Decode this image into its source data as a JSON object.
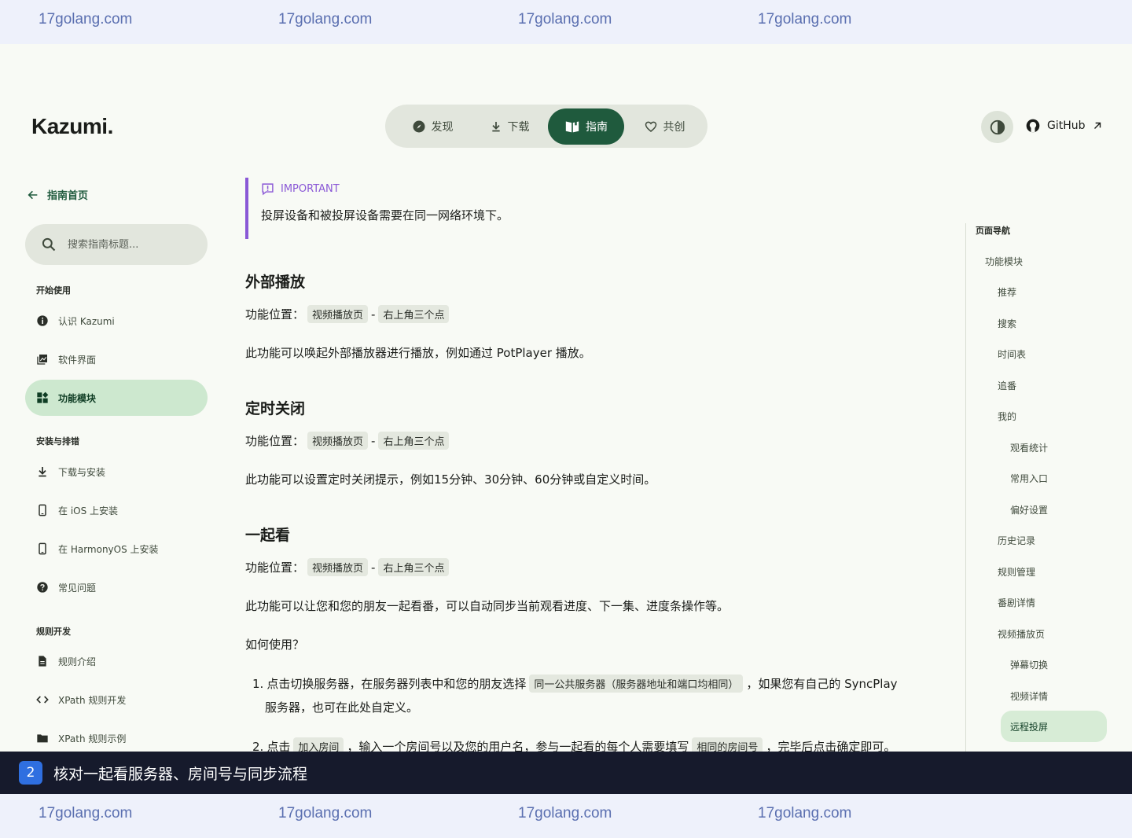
{
  "watermark": {
    "text": "17golang.com"
  },
  "brand": {
    "logo": "Kazumi."
  },
  "topnav": {
    "items": [
      {
        "label": "发现",
        "icon": "compass-icon"
      },
      {
        "label": "下载",
        "icon": "download-icon"
      },
      {
        "label": "指南",
        "icon": "book-icon"
      },
      {
        "label": "共创",
        "icon": "heart-icon"
      }
    ],
    "active": "指南"
  },
  "header": {
    "github_label": "GitHub"
  },
  "sidebar": {
    "back_label": "指南首页",
    "search_placeholder": "搜索指南标题...",
    "sections": [
      {
        "title": "开始使用",
        "items": [
          "认识 Kazumi",
          "软件界面",
          "功能模块"
        ]
      },
      {
        "title": "安装与排错",
        "items": [
          "下载与安装",
          "在 iOS 上安装",
          "在 HarmonyOS 上安装",
          "常见问题"
        ]
      },
      {
        "title": "规则开发",
        "items": [
          "规则介绍",
          "XPath 规则开发",
          "XPath 规则示例"
        ]
      }
    ],
    "active_item": "功能模块"
  },
  "callout": {
    "type": "IMPORTANT",
    "text": "投屏设备和被投屏设备需要在同一网络环境下。"
  },
  "content": {
    "sections": [
      {
        "heading": "外部播放",
        "location_label": "功能位置：",
        "loc1": "视频播放页",
        "sep": "-",
        "loc2": "右上角三个点",
        "desc": "此功能可以唤起外部播放器进行播放，例如通过 PotPlayer 播放。"
      },
      {
        "heading": "定时关闭",
        "location_label": "功能位置：",
        "loc1": "视频播放页",
        "sep": "-",
        "loc2": "右上角三个点",
        "desc": "此功能可以设置定时关闭提示，例如15分钟、30分钟、60分钟或自定义时间。"
      },
      {
        "heading": "一起看",
        "location_label": "功能位置：",
        "loc1": "视频播放页",
        "sep": "-",
        "loc2": "右上角三个点",
        "desc": "此功能可以让您和您的朋友一起看番，可以自动同步当前观看进度、下一集、进度条操作等。"
      }
    ],
    "howto": "如何使用？",
    "step1": {
      "num": "1.",
      "pre": "点击切换服务器，在服务器列表中和您的朋友选择",
      "code": "同一公共服务器（服务器地址和端口均相同）",
      "post": "，如果您有自己的 SyncPlay",
      "cont": "服务器，也可在此处自定义。"
    },
    "step2": {
      "num": "2.",
      "pre": "点击",
      "code1": "加入房间",
      "mid": "，输入一个房间号以及您的用户名，参与一起看的每个人需要填写",
      "code2": "相同的房间号",
      "post": "，完毕后点击确定即可。"
    }
  },
  "toc": {
    "title": "页面导航",
    "items": [
      {
        "label": "功能模块",
        "level": 1
      },
      {
        "label": "推荐",
        "level": 2
      },
      {
        "label": "搜索",
        "level": 2
      },
      {
        "label": "时间表",
        "level": 2
      },
      {
        "label": "追番",
        "level": 2
      },
      {
        "label": "我的",
        "level": 2
      },
      {
        "label": "观看统计",
        "level": 3
      },
      {
        "label": "常用入口",
        "level": 3
      },
      {
        "label": "偏好设置",
        "level": 3
      },
      {
        "label": "历史记录",
        "level": 2
      },
      {
        "label": "规则管理",
        "level": 2
      },
      {
        "label": "番剧详情",
        "level": 2
      },
      {
        "label": "视频播放页",
        "level": 2
      },
      {
        "label": "弹幕切换",
        "level": 3
      },
      {
        "label": "视频详情",
        "level": 3
      },
      {
        "label": "远程投屏",
        "level": 3
      }
    ],
    "active": "远程投屏"
  },
  "banner": {
    "step": "2",
    "text": "核对一起看服务器、房间号与同步流程"
  }
}
